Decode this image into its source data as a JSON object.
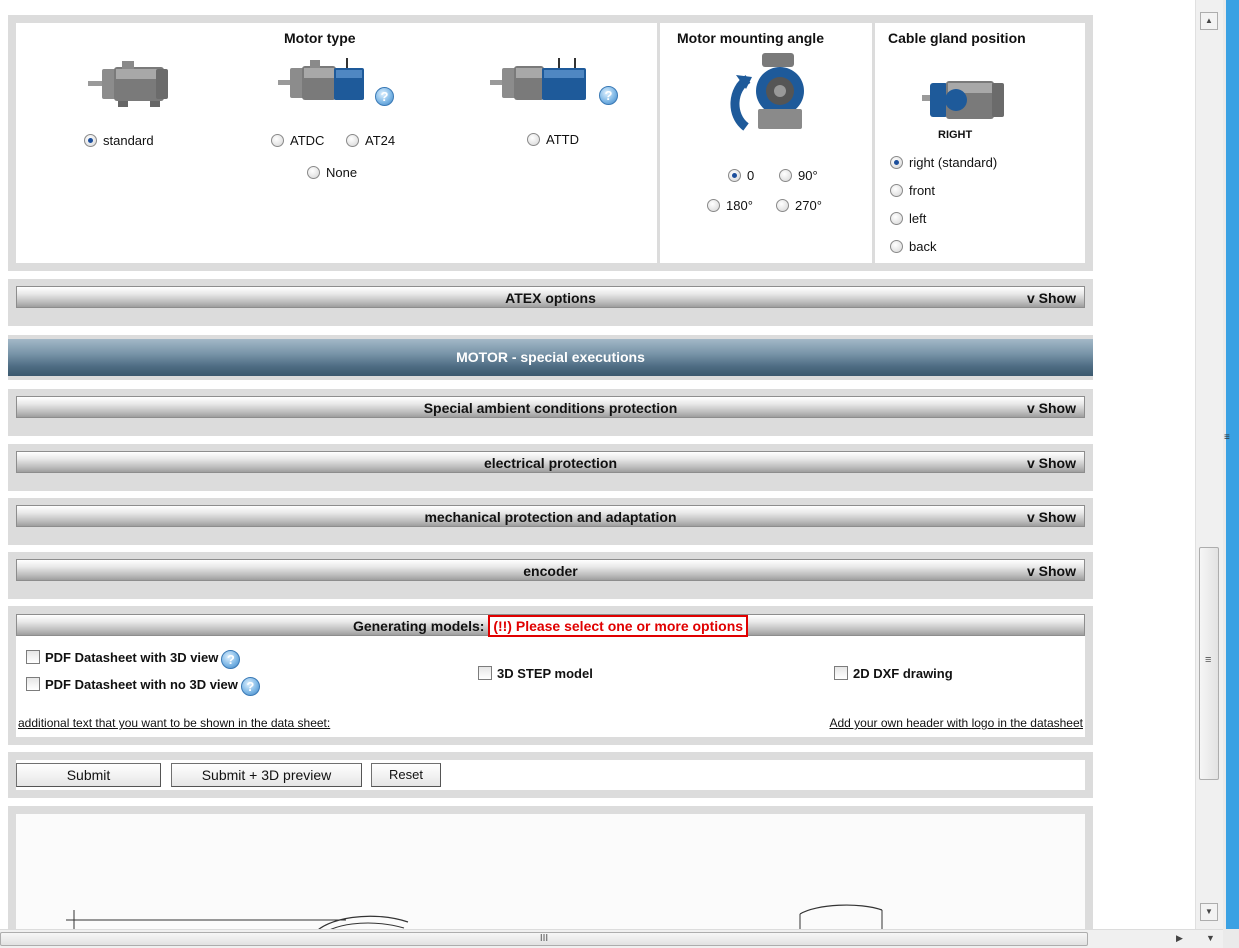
{
  "motor_type": {
    "title": "Motor type",
    "options": {
      "standard": "standard",
      "atdc": "ATDC",
      "at24": "AT24",
      "none": "None",
      "attd": "ATTD"
    },
    "selected": "standard",
    "help_glyph": "?"
  },
  "mounting_angle": {
    "title": "Motor mounting angle",
    "options": [
      "0",
      "90°",
      "180°",
      "270°"
    ],
    "selected": "0"
  },
  "cable_gland": {
    "title": "Cable gland position",
    "current_label": "RIGHT",
    "options": [
      "right (standard)",
      "front",
      "left",
      "back"
    ],
    "selected": "right (standard)"
  },
  "sections": {
    "atex": "ATEX options",
    "motor_special": "MOTOR - special executions",
    "ambient": "Special ambient conditions protection",
    "electrical": "electrical protection",
    "mechanical": "mechanical protection and adaptation",
    "encoder": "encoder",
    "toggle_label": "v Show"
  },
  "generating": {
    "label": "Generating models:",
    "warning": "(!!) Please select one or more options",
    "pdf_3d": "PDF Datasheet with 3D view",
    "pdf_no_3d": "PDF Datasheet with no 3D view",
    "step": "3D STEP model",
    "dxf": "2D DXF drawing",
    "additional_text_link": "additional text that you want to be shown in the data sheet:",
    "header_link": "Add your own header with logo in the datasheet"
  },
  "buttons": {
    "submit": "Submit",
    "submit_preview": "Submit + 3D preview",
    "reset": "Reset"
  },
  "scrollbar": {
    "grip": "III",
    "vgrip": "≡"
  },
  "colors": {
    "motor_blue": "#1e5a9a",
    "section_blue": "#4d6b82",
    "warning_red": "#e00000",
    "help_blue": "#3c82c4",
    "scroll_edge_blue": "#3aa1e3"
  }
}
